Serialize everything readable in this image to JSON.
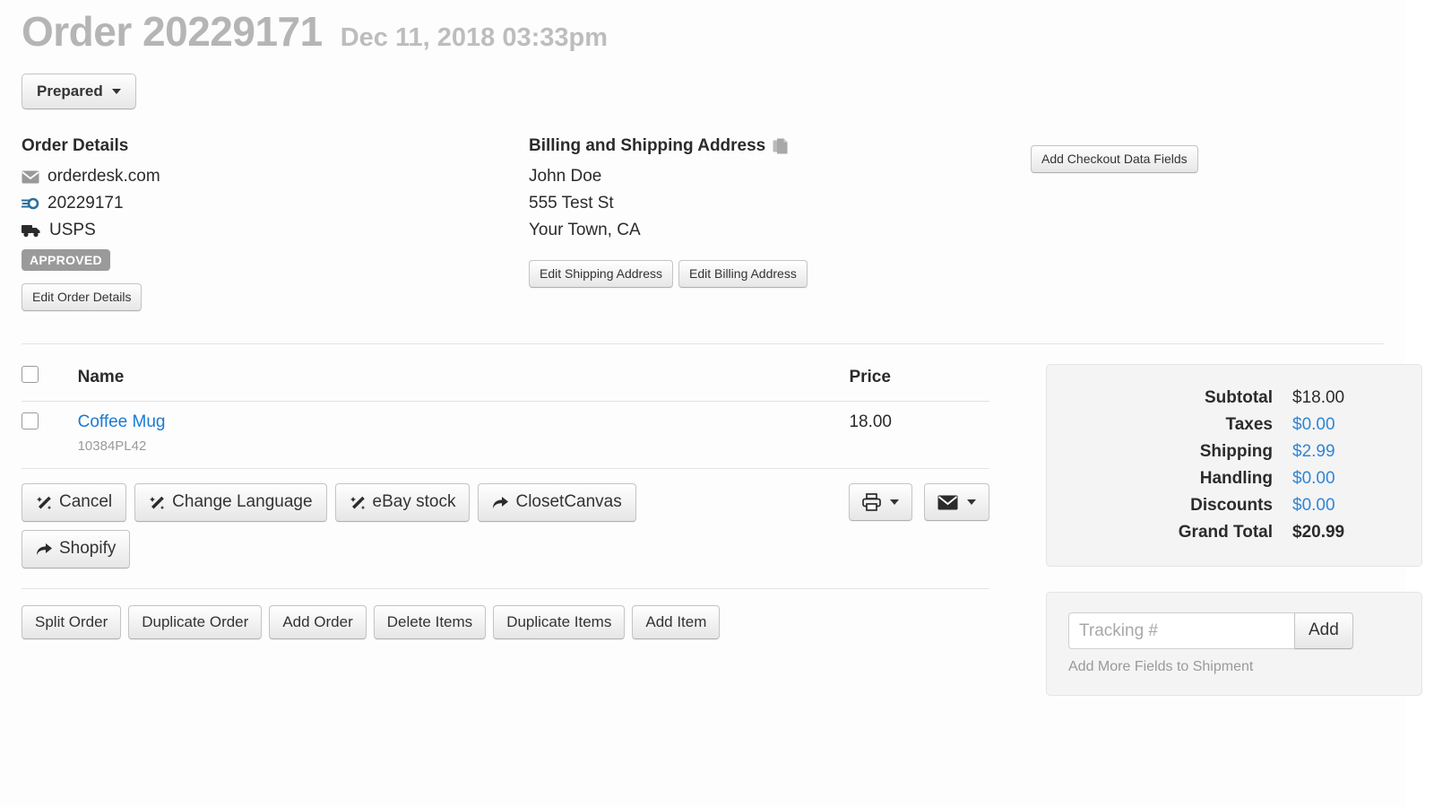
{
  "header": {
    "title": "Order 20229171",
    "date": "Dec 11, 2018 03:33pm",
    "status_button": "Prepared"
  },
  "order_details": {
    "heading": "Order Details",
    "source": "orderdesk.com",
    "order_number": "20229171",
    "carrier": "USPS",
    "status_badge": "APPROVED",
    "edit_button": "Edit Order Details",
    "icons": {
      "source": "envelope-icon",
      "order_number": "order-tag-icon",
      "carrier": "truck-icon"
    }
  },
  "address": {
    "heading": "Billing and Shipping Address",
    "copy_icon": "copy-icon",
    "lines": [
      "John Doe",
      "555 Test St",
      "Your Town, CA"
    ],
    "edit_shipping_button": "Edit Shipping Address",
    "edit_billing_button": "Edit Billing Address"
  },
  "checkout": {
    "add_fields_button": "Add Checkout Data Fields"
  },
  "items": {
    "columns": [
      "Name",
      "Price"
    ],
    "rows": [
      {
        "name": "Coffee Mug",
        "sku": "10384PL42",
        "price": "18.00"
      }
    ]
  },
  "item_actions": [
    {
      "label": "Cancel",
      "icon": "magic-wand-icon"
    },
    {
      "label": "Change Language",
      "icon": "magic-wand-icon"
    },
    {
      "label": "eBay stock",
      "icon": "magic-wand-icon"
    },
    {
      "label": "ClosetCanvas",
      "icon": "share-arrow-icon"
    },
    {
      "label": "Shopify",
      "icon": "share-arrow-icon"
    }
  ],
  "output_actions": [
    {
      "name": "print-dropdown",
      "icon": "printer-icon"
    },
    {
      "name": "email-dropdown",
      "icon": "envelope-icon"
    }
  ],
  "order_actions": [
    "Split Order",
    "Duplicate Order",
    "Add Order",
    "Delete Items",
    "Duplicate Items",
    "Add Item"
  ],
  "totals": [
    {
      "label": "Subtotal",
      "value": "$18.00",
      "style": "plain"
    },
    {
      "label": "Taxes",
      "value": "$0.00",
      "style": "link"
    },
    {
      "label": "Shipping",
      "value": "$2.99",
      "style": "link"
    },
    {
      "label": "Handling",
      "value": "$0.00",
      "style": "link"
    },
    {
      "label": "Discounts",
      "value": "$0.00",
      "style": "link"
    },
    {
      "label": "Grand Total",
      "value": "$20.99",
      "style": "strong"
    }
  ],
  "shipment": {
    "tracking_placeholder": "Tracking #",
    "tracking_value": "",
    "add_button": "Add",
    "add_fields_link": "Add More Fields to Shipment"
  },
  "colors": {
    "link": "#1a7ad4",
    "total_link": "#2f86d6",
    "badge": "#9a9a9a",
    "title": "#b5b5b5",
    "panel_bg": "#f4f4f4"
  }
}
